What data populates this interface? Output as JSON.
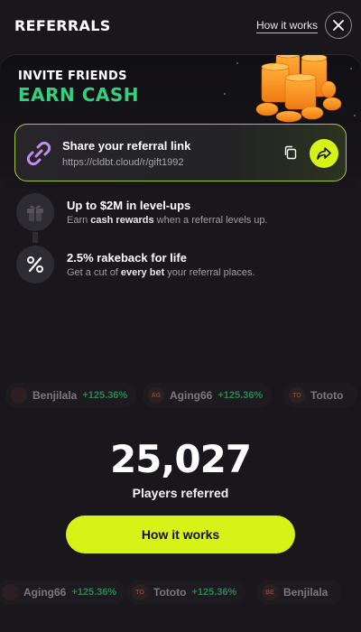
{
  "header": {
    "title": "REFERRALS",
    "how_it_works_link": "How it works",
    "close_icon": "close-icon"
  },
  "banner": {
    "line1": "INVITE FRIENDS",
    "line2": "EARN CASH",
    "accent_color": "#35d07f",
    "illustration": "coin-stacks"
  },
  "share": {
    "title": "Share your referral link",
    "url": "https://cldbt.cloud/r/gift1992",
    "link_icon": "link-icon",
    "copy_icon": "copy-icon",
    "share_icon": "share-arrow-icon",
    "accent_color": "#d7f217"
  },
  "perks": [
    {
      "icon": "gift-icon",
      "title": "Up to $2M in level-ups",
      "desc_pre": "Earn ",
      "desc_bold": "cash rewards",
      "desc_post": " when a referral levels up."
    },
    {
      "icon": "percent-icon",
      "title": "2.5% rakeback for life",
      "desc_pre": "Get a cut of ",
      "desc_bold": "every bet",
      "desc_post": " your referral places."
    }
  ],
  "ticker_top": [
    {
      "avatar": "",
      "name": "Benjilala",
      "pct": "+125.36%"
    },
    {
      "avatar": "AG",
      "name": "Aging66",
      "pct": "+125.36%"
    },
    {
      "avatar": "TO",
      "name": "Tototo",
      "pct": ""
    }
  ],
  "ticker_bottom": [
    {
      "avatar": "",
      "name": "Aging66",
      "pct": "+125.36%"
    },
    {
      "avatar": "TO",
      "name": "Tototo",
      "pct": "+125.36%"
    },
    {
      "avatar": "BE",
      "name": "Benjilala",
      "pct": ""
    }
  ],
  "stats": {
    "count": "25,027",
    "label": "Players referred"
  },
  "cta": {
    "label": "How it works"
  }
}
